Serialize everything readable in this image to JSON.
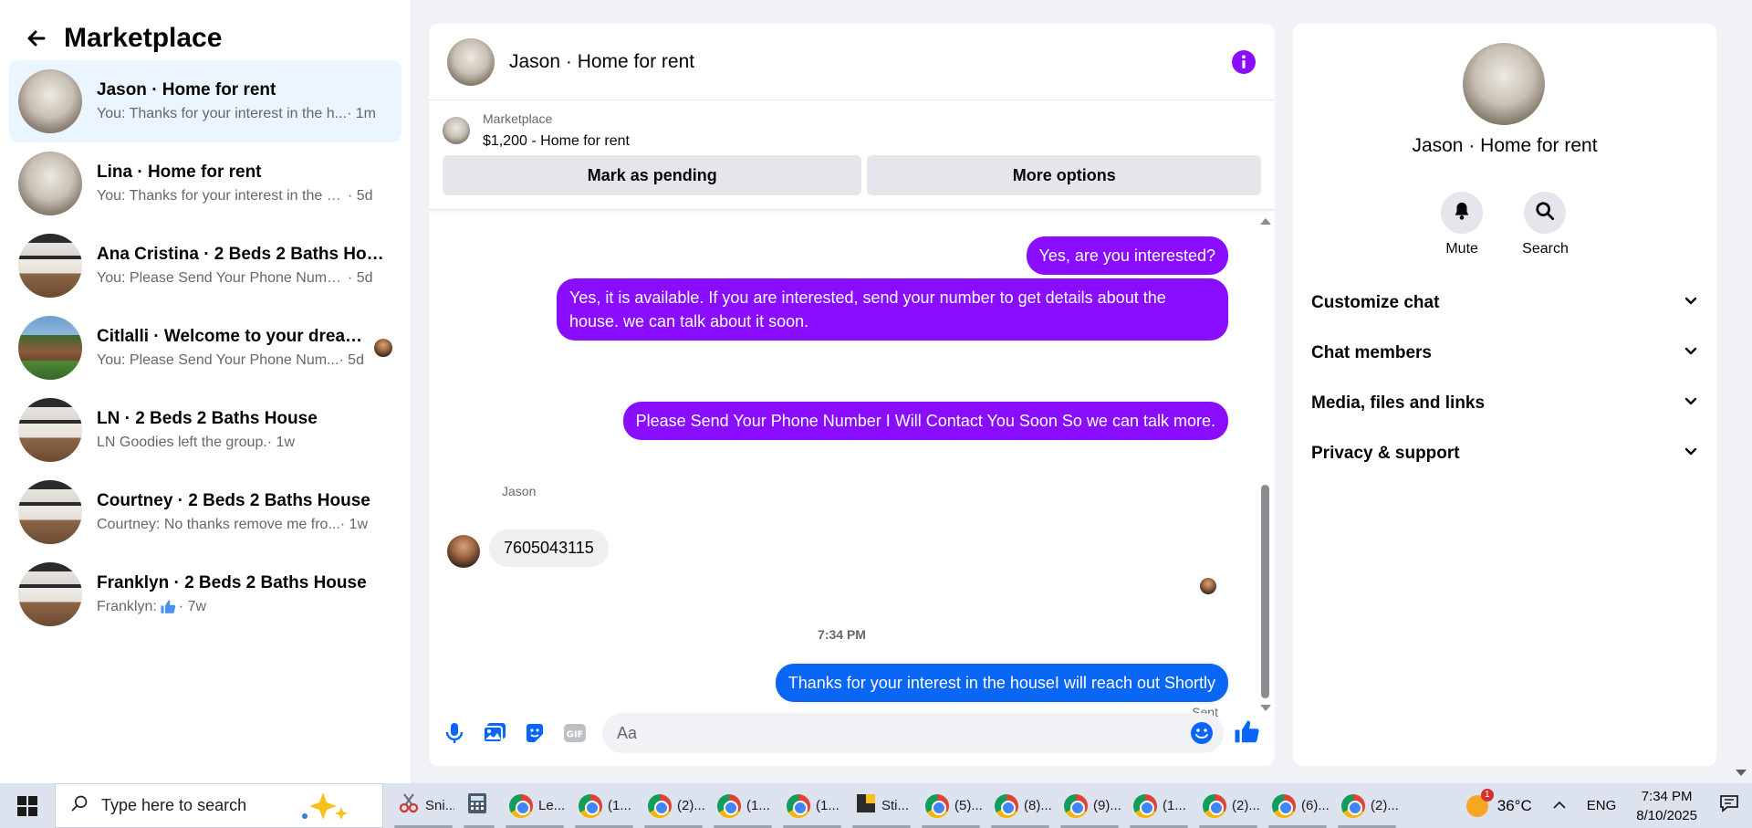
{
  "sidebar": {
    "title": "Marketplace",
    "conversations": [
      {
        "name": "Jason · Home for rent",
        "preview": "You: Thanks for your interest in the h...",
        "time": "· 1m",
        "active": true
      },
      {
        "name": "Lina · Home for rent",
        "preview": "You: Thanks for your interest in the ho...",
        "time": "· 5d"
      },
      {
        "name": "Ana Cristina · 2 Beds 2 Baths House",
        "preview": "You: Please Send Your Phone Number...",
        "time": "· 5d"
      },
      {
        "name": "Citlalli · Welcome to your dream...",
        "preview": "You: Please Send Your Phone Num...",
        "time": "· 5d"
      },
      {
        "name": "LN · 2 Beds 2 Baths House",
        "preview": "LN Goodies left the group.",
        "time": "· 1w"
      },
      {
        "name": "Courtney · 2 Beds 2 Baths House",
        "preview": "Courtney: No thanks remove me fro...",
        "time": "· 1w"
      },
      {
        "name": "Franklyn · 2 Beds 2 Baths House",
        "preview": "Franklyn:",
        "time": "· 7w"
      }
    ]
  },
  "chat": {
    "title": "Jason · Home for rent",
    "marketplace_label": "Marketplace",
    "listing": "$1,200 - Home for rent",
    "mark_pending": "Mark as pending",
    "more_options": "More options",
    "messages": {
      "m1": "Yes, are you interested?",
      "m2": "Yes, it is available. If you are interested, send your number to get details about the house. we can talk about it soon.",
      "m3": "Please Send Your Phone Number I Will Contact You Soon So we can talk more.",
      "sender": "Jason",
      "m4": "7605043115",
      "time_separator": "7:34 PM",
      "m5": "Thanks for your interest in the houseI will reach out Shortly",
      "status": "Sent"
    },
    "composer_placeholder": "Aa"
  },
  "info_panel": {
    "name": "Jason · Home for rent",
    "actions": {
      "mute": "Mute",
      "search": "Search"
    },
    "sections": [
      "Customize chat",
      "Chat members",
      "Media, files and links",
      "Privacy & support"
    ]
  },
  "taskbar": {
    "search_placeholder": "Type here to search",
    "apps": [
      "Sni...",
      "",
      "Le...",
      "(1...",
      "(2)...",
      "(1...",
      "(1...",
      "Sti...",
      "(5)...",
      "(8)...",
      "(9)...",
      "(1...",
      "(2)...",
      "(6)...",
      "(2)..."
    ],
    "weather_badge": "1",
    "temperature": "36°C",
    "language": "ENG",
    "time": "7:34 PM",
    "date": "8/10/2025"
  },
  "colors": {
    "purple_bubble": "#8a0dff",
    "blue_bubble": "#0a66f4",
    "accent": "#0866ff"
  }
}
